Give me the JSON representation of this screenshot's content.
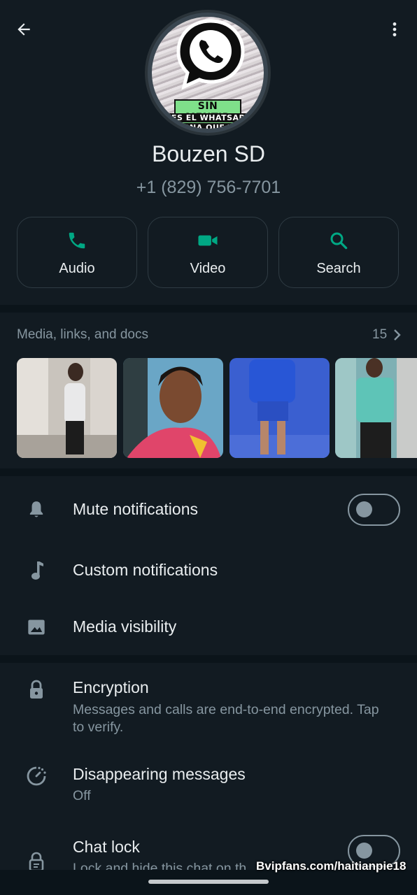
{
  "header": {
    "back_icon": "arrow-left-icon",
    "more_icon": "more-vertical-icon"
  },
  "avatar": {
    "banner_top": "SIN MENTIR",
    "banner_line1": "NES EL WHATSAPP",
    "banner_line2": "RONA QUE TE"
  },
  "contact": {
    "name": "Bouzen SD",
    "phone": "+1 (829) 756-7701"
  },
  "actions": [
    {
      "label": "Audio",
      "icon": "phone-icon"
    },
    {
      "label": "Video",
      "icon": "video-camera-icon"
    },
    {
      "label": "Search",
      "icon": "search-icon"
    }
  ],
  "media": {
    "title": "Media, links, and docs",
    "count": "15"
  },
  "settings": {
    "mute": "Mute notifications",
    "custom": "Custom notifications",
    "visibility": "Media visibility",
    "encryption": "Encryption",
    "encryption_sub": "Messages and calls are end-to-end encrypted. Tap to verify.",
    "disappearing": "Disappearing messages",
    "disappearing_sub": "Off",
    "chat_lock": "Chat lock",
    "chat_lock_sub": "Lock and hide this chat on th"
  },
  "toggles": {
    "mute_on": false,
    "chat_lock_on": false
  },
  "watermark": "Bvipfans.com/haitianpie18",
  "colors": {
    "background": "#121b22",
    "accent": "#00a884",
    "muted": "#8696a0"
  }
}
